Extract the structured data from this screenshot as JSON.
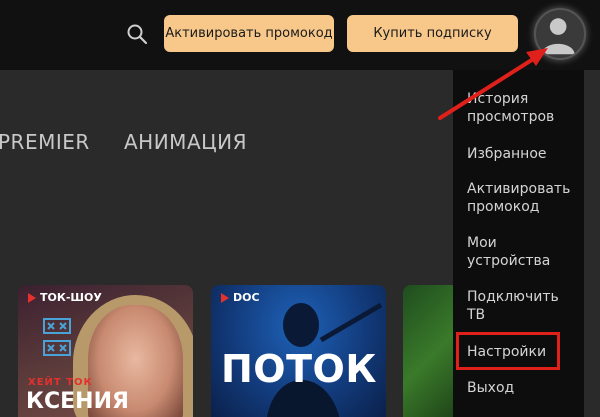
{
  "header": {
    "promo_button": "Активировать промокод",
    "subscribe_button": "Купить подписку"
  },
  "tabs": [
    {
      "label": "PREMIER"
    },
    {
      "label": "АНИМАЦИЯ"
    }
  ],
  "cards": [
    {
      "badge": "ТОК-ШОУ",
      "subtitle": "ХЕЙТ ТОК",
      "title": "КСЕНИЯ"
    },
    {
      "badge": "DOC",
      "title": "ПОТОК"
    },
    {}
  ],
  "menu": {
    "items": [
      {
        "label": "История\nпросмотров"
      },
      {
        "label": "Избранное"
      },
      {
        "label": "Активировать\nпромокод"
      },
      {
        "label": "Мои\nустройства"
      },
      {
        "label": "Подключить\nТВ"
      },
      {
        "label": "Настройки"
      },
      {
        "label": "Выход"
      }
    ]
  },
  "annotation": {
    "highlight_color": "#e0201a"
  },
  "colors": {
    "accent_button": "#f7c88a",
    "badge_play": "#e5312d"
  }
}
